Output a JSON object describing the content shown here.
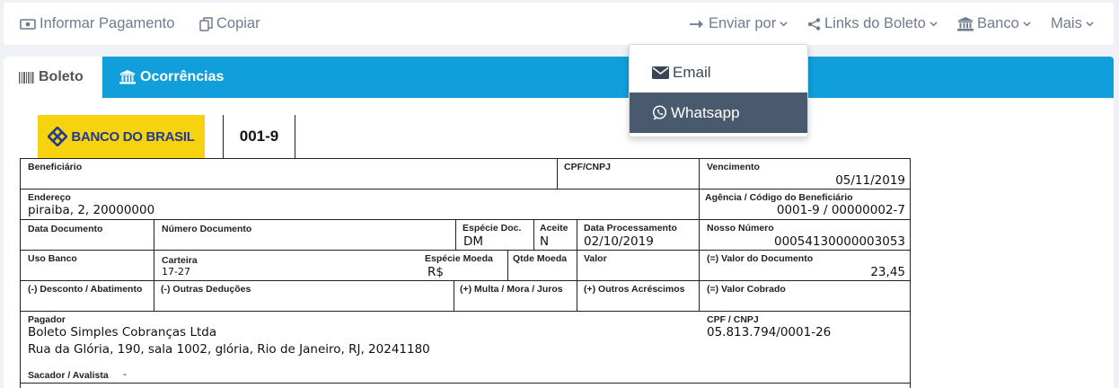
{
  "toolbar": {
    "informar_pagamento": "Informar Pagamento",
    "copiar": "Copiar",
    "enviar_por": "Enviar por",
    "links_do_boleto": "Links do Boleto",
    "banco": "Banco",
    "mais": "Mais"
  },
  "tabs": [
    {
      "label": "Boleto",
      "active": true
    },
    {
      "label": "Ocorrências",
      "active": false
    }
  ],
  "dropdown": {
    "items": [
      {
        "label": "Email",
        "icon": "envelope-icon",
        "selected": false
      },
      {
        "label": "Whatsapp",
        "icon": "whatsapp-icon",
        "selected": true
      }
    ]
  },
  "bank": {
    "name": "BANCO DO BRASIL",
    "code": "001-9",
    "brand_color": "#f6d20f",
    "text_color": "#233a8f"
  },
  "boleto": {
    "beneficiario": {
      "label": "Beneficiário",
      "value": ""
    },
    "cpf_cnpj": {
      "label": "CPF/CNPJ",
      "value": ""
    },
    "vencimento": {
      "label": "Vencimento",
      "value": "05/11/2019"
    },
    "endereco": {
      "label": "Endereço",
      "value": "piraiba, 2, 20000000"
    },
    "agencia": {
      "label": "Agência / Código do Beneficiário",
      "value": "0001-9 / 00000002-7"
    },
    "data_documento": {
      "label": "Data Documento",
      "value": ""
    },
    "numero_documento": {
      "label": "Número Documento",
      "value": ""
    },
    "especie_doc": {
      "label": "Espécie Doc.",
      "value": "DM"
    },
    "aceite": {
      "label": "Aceite",
      "value": "N"
    },
    "data_processamento": {
      "label": "Data Processamento",
      "value": "02/10/2019"
    },
    "nosso_numero": {
      "label": "Nosso Número",
      "value": "00054130000003053"
    },
    "uso_banco": {
      "label": "Uso Banco",
      "value": ""
    },
    "carteira": {
      "label": "Carteira",
      "value": "17-27"
    },
    "especie_moeda": {
      "label": "Espécie Moeda",
      "value": "R$"
    },
    "qtde_moeda": {
      "label": "Qtde Moeda",
      "value": ""
    },
    "valor": {
      "label": "Valor",
      "value": ""
    },
    "valor_documento": {
      "label": "(=) Valor do Documento",
      "value": "23,45"
    },
    "desconto": {
      "label": "(-) Desconto / Abatimento"
    },
    "outras_deducoes": {
      "label": "(-) Outras Deduções"
    },
    "multa": {
      "label": "(+) Multa / Mora / Juros"
    },
    "outros_acrescimos": {
      "label": "(+) Outros Acréscimos"
    },
    "valor_cobrado": {
      "label": "(=) Valor Cobrado"
    },
    "pagador": {
      "label": "Pagador",
      "name": "Boleto Simples Cobranças Ltda",
      "address": "Rua da Glória, 190, sala 1002, glória, Rio de Janeiro, RJ, 20241180"
    },
    "pagador_cpf_cnpj": {
      "label": "CPF / CNPJ",
      "value": "05.813.794/0001-26"
    },
    "sacador": {
      "label": "Sacador / Avalista",
      "value": "-"
    }
  }
}
